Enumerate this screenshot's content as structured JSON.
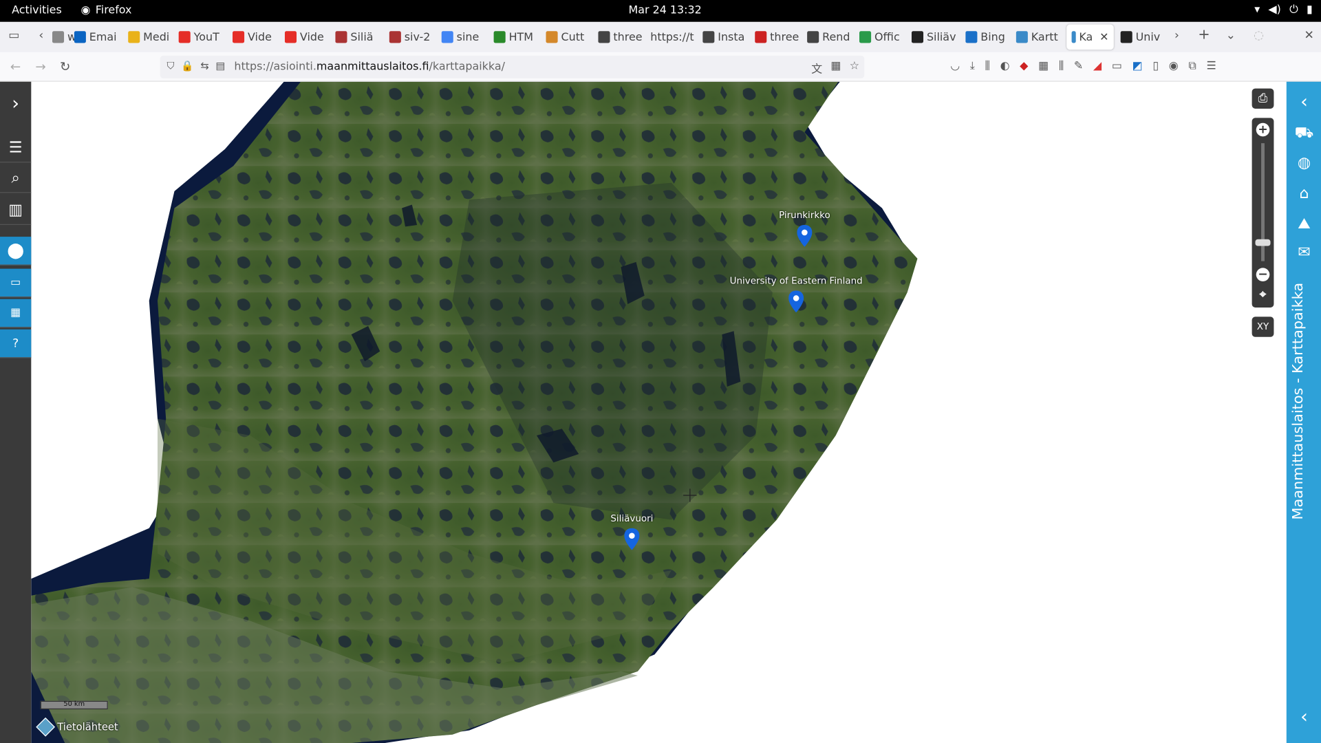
{
  "system": {
    "activities": "Activities",
    "app_name": "Firefox",
    "clock": "Mar 24  13:32"
  },
  "tabs": [
    {
      "label": "w",
      "icon": "page-icon"
    },
    {
      "label": "Emai",
      "icon": "outlook-icon",
      "color": "#0a64c2"
    },
    {
      "label": "Medi",
      "icon": "folder-icon",
      "color": "#e9b21a"
    },
    {
      "label": "YouT",
      "icon": "youtube-icon",
      "color": "#e52d27"
    },
    {
      "label": "Vide",
      "icon": "youtube-icon",
      "color": "#e52d27"
    },
    {
      "label": "Vide",
      "icon": "youtube-icon",
      "color": "#e52d27"
    },
    {
      "label": "Siliä",
      "icon": "anchor-icon",
      "color": "#a33"
    },
    {
      "label": "siv-2",
      "icon": "anchor-icon",
      "color": "#a33"
    },
    {
      "label": "sine",
      "icon": "google-icon",
      "color": "#4285f4"
    },
    {
      "label": "HTM",
      "icon": "w-icon",
      "color": "#2a8a2a"
    },
    {
      "label": "Cutt",
      "icon": "tool-icon",
      "color": "#d4882a"
    },
    {
      "label": "three",
      "icon": "flag-icon",
      "color": "#444"
    },
    {
      "label": "https://t",
      "icon": "",
      "color": "#444"
    },
    {
      "label": "Insta",
      "icon": "flag-icon",
      "color": "#444"
    },
    {
      "label": "three",
      "icon": "square-icon",
      "color": "#c22"
    },
    {
      "label": "Rend",
      "icon": "flag-icon",
      "color": "#444"
    },
    {
      "label": "Offic",
      "icon": "diamond-icon",
      "color": "#2a9a4a"
    },
    {
      "label": "Siliäv",
      "icon": "wiki-icon",
      "color": "#222"
    },
    {
      "label": "Bing",
      "icon": "search-icon",
      "color": "#1a70c8"
    },
    {
      "label": "Kartt",
      "icon": "globe-icon",
      "color": "#3a8ac8"
    },
    {
      "label": "Ka",
      "icon": "globe-icon",
      "color": "#3a8ac8",
      "active": true
    },
    {
      "label": "Univ",
      "icon": "globe-icon",
      "color": "#222"
    }
  ],
  "navbar": {
    "url_prefix": "https://asiointi.",
    "url_domain": "maanmittauslaitos.fi",
    "url_path": "/karttapaikka/"
  },
  "map": {
    "markers": [
      {
        "label": "Pirunkirkko"
      },
      {
        "label": "University of Eastern Finland"
      },
      {
        "label": "Siliävuori"
      }
    ],
    "scale_label": "50 km",
    "data_sources": "Tietolähteet",
    "side_title": "Maanmittauslaitos - Karttapaikka",
    "xy_label": "XY"
  },
  "colors": {
    "accent": "#2ea1d8",
    "marker": "#1565e0",
    "toolbar": "#3a3a3a"
  }
}
